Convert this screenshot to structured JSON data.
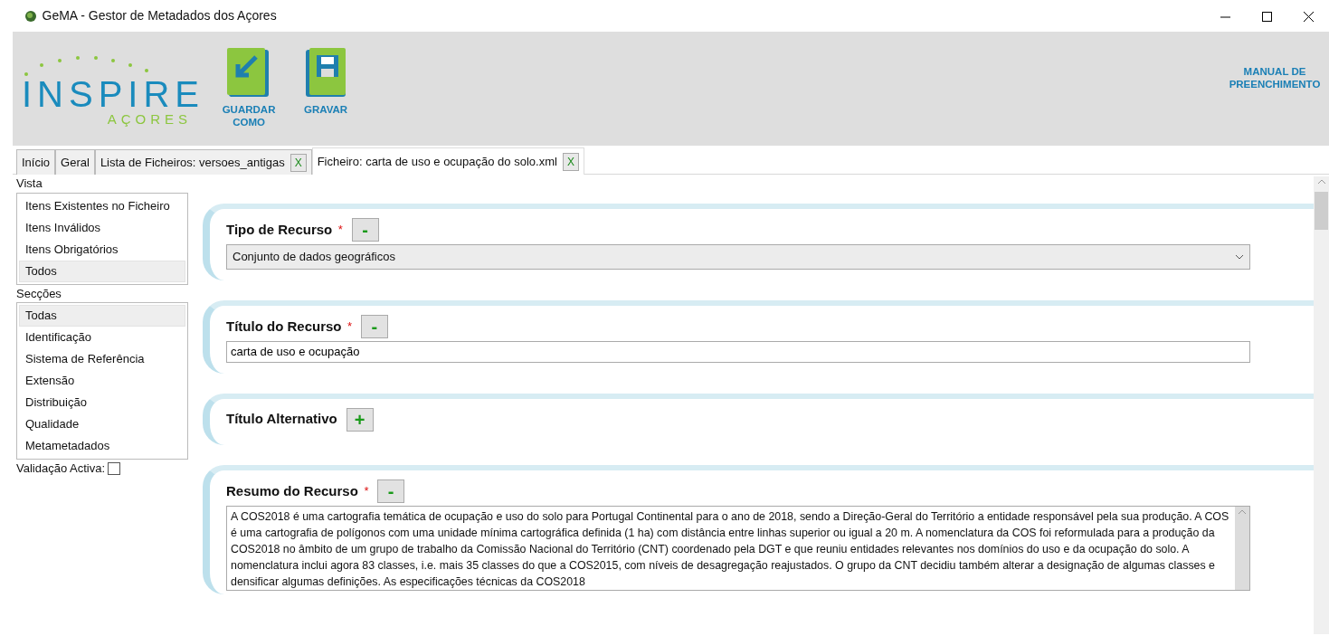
{
  "window": {
    "title": "GeMA - Gestor de Metadados dos Açores"
  },
  "header": {
    "logo": {
      "title": "INSPIRE",
      "subtitle": "AÇORES"
    },
    "buttons": [
      {
        "label": "GUARDAR COMO",
        "kind": "save-as"
      },
      {
        "label": "GRAVAR",
        "kind": "save"
      }
    ],
    "manual_link": "MANUAL DE PREENCHIMENTO"
  },
  "tabs": [
    {
      "label": "Início",
      "selected": false
    },
    {
      "label": "Geral",
      "selected": false
    },
    {
      "label": "Lista de Ficheiros: versoes_antigas",
      "selected": false,
      "close_label": "X"
    },
    {
      "label": "Ficheiro: carta de uso e ocupação do solo.xml",
      "selected": true,
      "close_label": "X"
    }
  ],
  "sidebar": {
    "vista_label": "Vista",
    "vista": [
      {
        "label": "Itens Existentes no Ficheiro",
        "selected": false
      },
      {
        "label": "Itens Inválidos",
        "selected": false
      },
      {
        "label": "Itens Obrigatórios",
        "selected": false
      },
      {
        "label": "Todos",
        "selected": true
      }
    ],
    "seccoes_label": "Secções",
    "seccoes": [
      {
        "label": "Todas",
        "selected": true
      },
      {
        "label": "Identificação",
        "selected": false
      },
      {
        "label": "Sistema de Referência",
        "selected": false
      },
      {
        "label": "Extensão",
        "selected": false
      },
      {
        "label": "Distribuição",
        "selected": false
      },
      {
        "label": "Qualidade",
        "selected": false
      },
      {
        "label": "Metametadados",
        "selected": false
      }
    ],
    "validation": {
      "label": "Validação Activa:",
      "checked": false
    }
  },
  "sections": [
    {
      "title": "Tipo de Recurso",
      "required_mark": "*",
      "toggle": "-",
      "kind": "select",
      "value": "Conjunto de dados geográficos"
    },
    {
      "title": "Título do Recurso",
      "required_mark": "*",
      "toggle": "-",
      "kind": "text",
      "value": "carta de uso e ocupação"
    },
    {
      "title": "Título Alternativo",
      "toggle": "+"
    },
    {
      "title": "Resumo do Recurso",
      "required_mark": "*",
      "toggle": "-",
      "kind": "textarea",
      "value": "A COS2018 é uma cartografia temática de ocupação e uso do solo para Portugal Continental para o ano de 2018, sendo a Direção-Geral do Território a entidade responsável pela sua produção. A COS é uma cartografia de polígonos com uma unidade mínima cartográfica definida (1 ha) com distância entre linhas superior ou igual a 20 m. A nomenclatura da COS foi reformulada para a produção da COS2018 no âmbito de um grupo de trabalho da Comissão Nacional do Território (CNT) coordenado pela DGT e que reuniu entidades relevantes nos domínios do uso e da ocupação do solo. A nomenclatura inclui agora 83 classes, i.e. mais 35 classes do que a COS2015, com níveis de desagregação reajustados. O grupo da CNT decidiu também alterar a designação de algumas classes e densificar algumas definições. As especificações técnicas da COS2018"
    }
  ]
}
